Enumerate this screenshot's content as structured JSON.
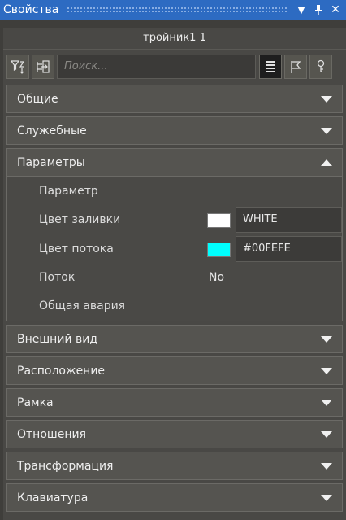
{
  "window": {
    "title": "Свойства"
  },
  "object": {
    "name": "тройник1 1"
  },
  "search": {
    "placeholder": "Поиск..."
  },
  "sections": {
    "general": "Общие",
    "service": "Служебные",
    "parameters": "Параметры",
    "appearance": "Внешний вид",
    "location": "Расположение",
    "frame": "Рамка",
    "relations": "Отношения",
    "transform": "Трансформация",
    "keyboard": "Клавиатура"
  },
  "params": {
    "param": {
      "label": "Параметр"
    },
    "fill_color": {
      "label": "Цвет заливки",
      "value": "WHITE",
      "swatch": "#ffffff"
    },
    "flow_color": {
      "label": "Цвет потока",
      "value": "#00FEFE",
      "swatch": "#00fefe"
    },
    "flow": {
      "label": "Поток",
      "value": "No"
    },
    "alarm": {
      "label": "Общая авария"
    }
  },
  "colors": {
    "titlebar": "#2d6bc2",
    "panel": "#494845",
    "section": "#555450"
  }
}
